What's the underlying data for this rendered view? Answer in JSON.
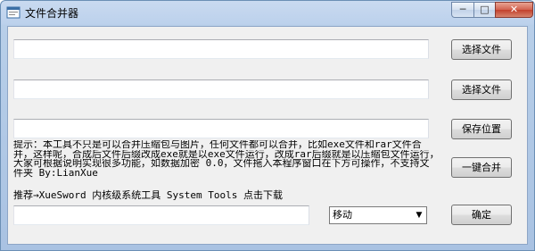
{
  "window": {
    "title": "文件合并器",
    "min_label": "─",
    "max_label": "□",
    "close_label": "✕"
  },
  "file1": {
    "value": "",
    "button": "选择文件"
  },
  "file2": {
    "value": "",
    "button": "选择文件"
  },
  "save": {
    "value": "",
    "button": "保存位置"
  },
  "hint_lines": [
    "提示：本工具不只是可以合并压缩包与图片，任何文件都可以合并，比如exe文件和rar文件合",
    "并，这样呢，合成后文件后缀改成exe就是以exe文件运行，改成rar后缀就是以压缩包文件运行，",
    "大家可根据说明实现很多功能，如数据加密 0.0，文件拖入本程序窗口在下方可操作，不支持文",
    "件夹 By:LianXue"
  ],
  "merge_button": "一键合并",
  "recommend_text": "推荐→XueSword 内核级系统工具 System Tools 点击下载",
  "drop": {
    "value": ""
  },
  "action": {
    "selected": "移动",
    "arrow": "▼"
  },
  "confirm_button": "确定"
}
